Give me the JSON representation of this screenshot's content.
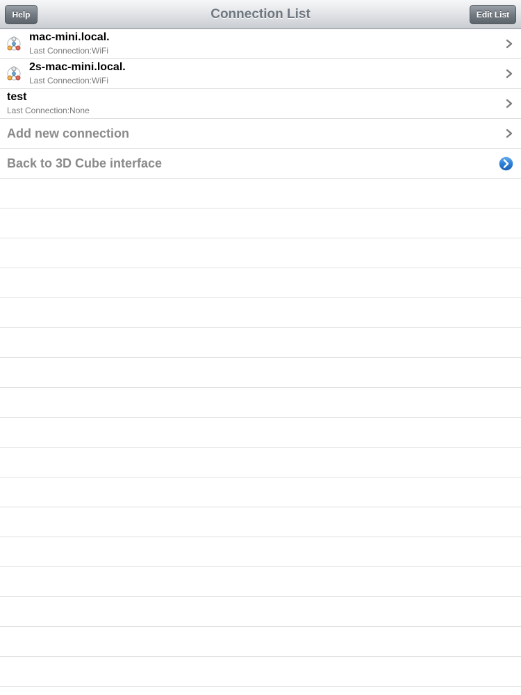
{
  "navbar": {
    "title": "Connection List",
    "left_button": "Help",
    "right_button": "Edit List"
  },
  "connections": [
    {
      "name": "mac-mini.local.",
      "subtitle": "Last Connection:WiFi",
      "icon": "server-node-icon"
    },
    {
      "name": "2s-mac-mini.local.",
      "subtitle": "Last Connection:WiFi",
      "icon": "server-node-icon"
    },
    {
      "name": "test",
      "subtitle": "Last Connection:None",
      "icon": null
    }
  ],
  "actions": {
    "add_label": "Add new connection",
    "back_label": "Back to 3D Cube interface"
  },
  "colors": {
    "detail_blue": "#2b7fd8",
    "chevron": "#7b7b7b"
  }
}
